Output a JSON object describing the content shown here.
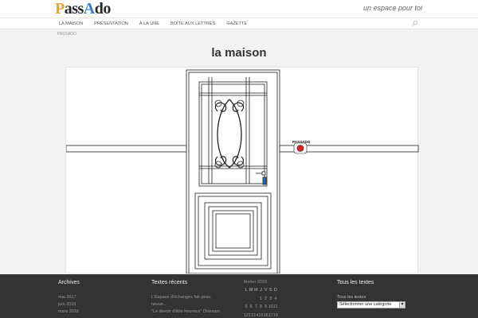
{
  "header": {
    "logo": {
      "p": "P",
      "ass": "ass",
      "a": "A",
      "do": "do"
    },
    "tagline": "un espace pour toi"
  },
  "nav": {
    "items": [
      "LA MAISON",
      "PRÉSENTATION",
      "À LA UNE",
      "BOÎTE AUX LETTRES",
      "GAZETTE"
    ],
    "search_icon": "search-icon"
  },
  "breadcrumb": "PASSADO",
  "page": {
    "title": "la maison",
    "door_label": "PASSADO"
  },
  "footer": {
    "archives": {
      "title": "Archives",
      "items": [
        "mai 2017",
        "juin 2016",
        "mars 2016"
      ]
    },
    "recent": {
      "title": "Textes récents",
      "items": [
        "L'Espace d'échanges fait peau",
        "neuve…",
        "\"Le devoir d'être heureux\" Omraam"
      ]
    },
    "calendar": {
      "caption": "février 2018",
      "days": [
        "L",
        "M",
        "M",
        "J",
        "V",
        "S",
        "D"
      ],
      "rows": [
        [
          "",
          "",
          "",
          "1",
          "2",
          "3",
          "4"
        ],
        [
          "5",
          "6",
          "7",
          "8",
          "9",
          "10",
          "11"
        ],
        [
          "12",
          "13",
          "14",
          "15",
          "16",
          "17",
          "18"
        ]
      ]
    },
    "categories": {
      "title": "Tous les textes",
      "label": "Tous les textes",
      "select_value": "Sélectionner une catégorie"
    }
  },
  "colors": {
    "logo_orange": "#f0a22b",
    "logo_blue": "#3e7fc2",
    "footer_bg": "#333333",
    "button_red": "#e02020"
  }
}
